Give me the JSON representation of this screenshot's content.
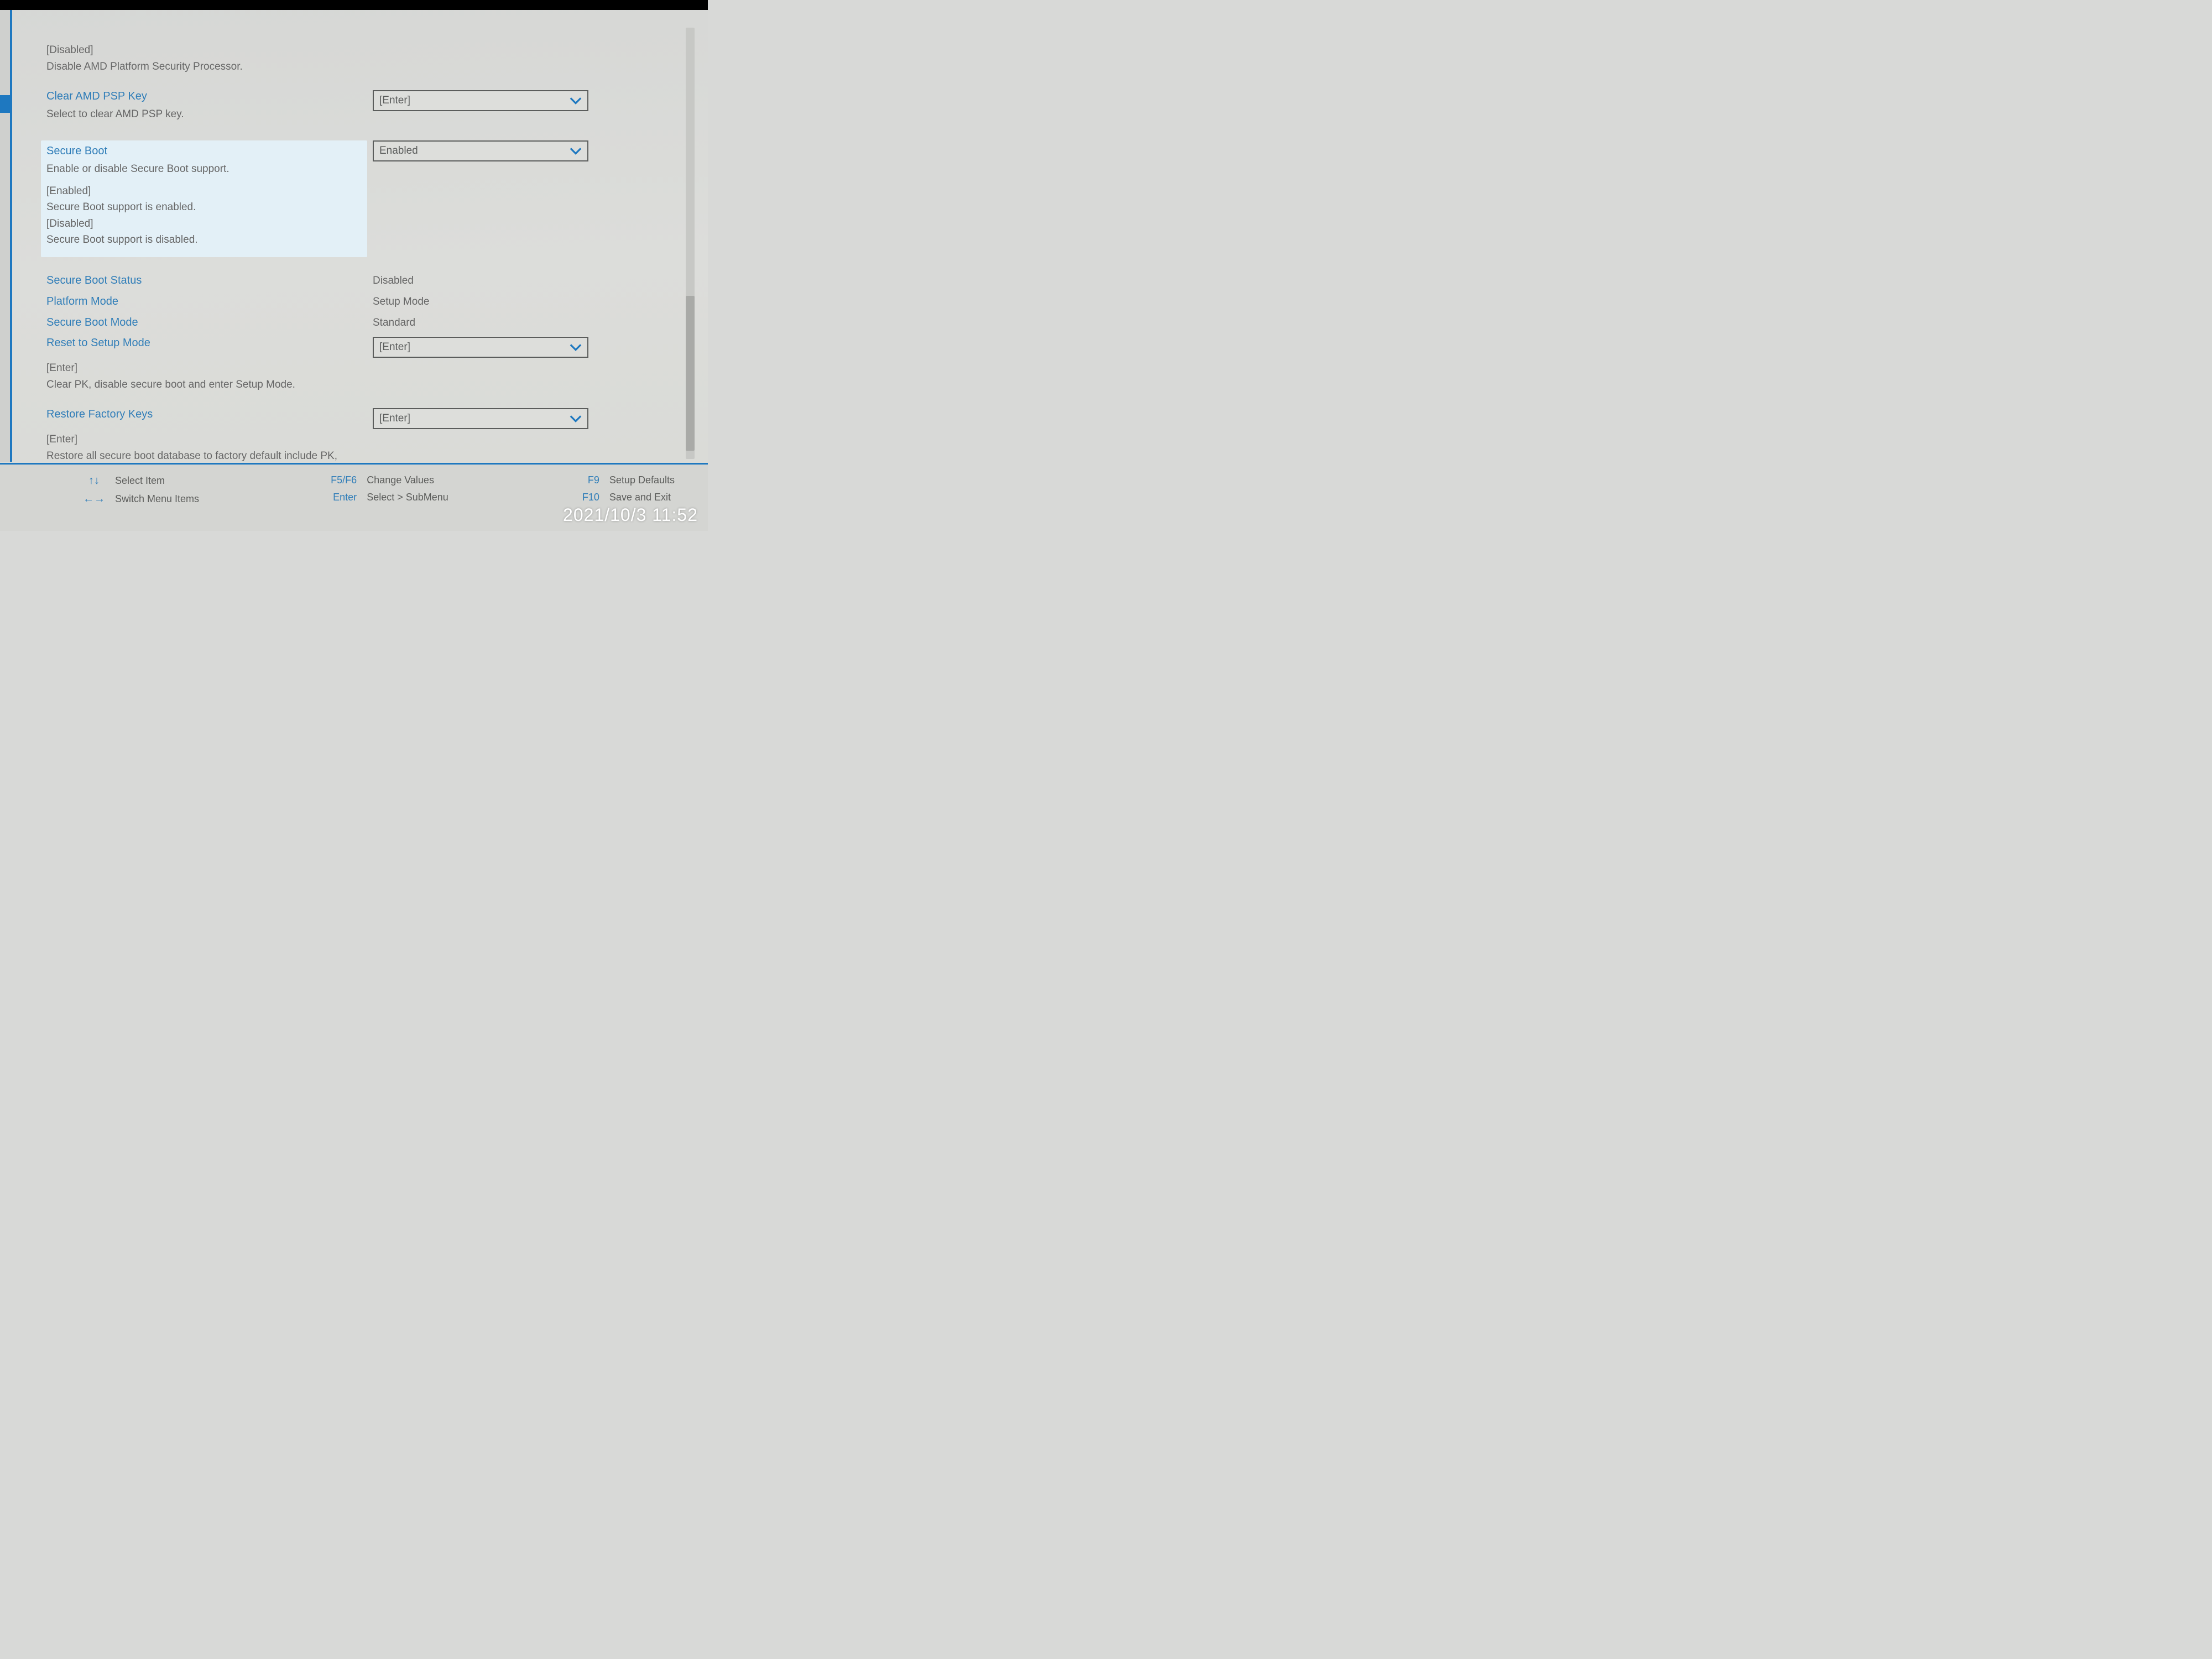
{
  "top": {
    "disabled_tag": "[Disabled]",
    "disabled_desc": "Disable AMD Platform Security Processor."
  },
  "clear_psp": {
    "title": "Clear AMD PSP Key",
    "desc": "Select to clear AMD PSP key.",
    "value": "[Enter]"
  },
  "secure_boot": {
    "title": "Secure Boot",
    "desc": "Enable or disable Secure Boot support.",
    "enabled_tag": "[Enabled]",
    "enabled_desc": "Secure Boot support is enabled.",
    "disabled_tag": "[Disabled]",
    "disabled_desc": "Secure Boot support is disabled.",
    "value": "Enabled"
  },
  "status": {
    "secure_boot_status_label": "Secure Boot Status",
    "secure_boot_status_value": "Disabled",
    "platform_mode_label": "Platform Mode",
    "platform_mode_value": "Setup Mode",
    "secure_boot_mode_label": "Secure Boot Mode",
    "secure_boot_mode_value": "Standard"
  },
  "reset_setup": {
    "title": "Reset to Setup Mode",
    "value": "[Enter]",
    "enter_tag": "[Enter]",
    "desc": "Clear PK, disable secure boot and enter Setup Mode."
  },
  "restore": {
    "title": "Restore Factory Keys",
    "value": "[Enter]",
    "enter_tag": "[Enter]",
    "desc": "Restore all secure boot database to factory default include PK, KEK, db and dbx."
  },
  "footer": {
    "select_item": "Select Item",
    "switch_menu": "Switch Menu Items",
    "f5f6": "F5/F6",
    "change_values": "Change Values",
    "enter": "Enter",
    "select_submenu": "Select > SubMenu",
    "f9": "F9",
    "setup_defaults": "Setup Defaults",
    "f10": "F10",
    "save_exit": "Save and Exit"
  },
  "timestamp": "2021/10/3 11:52"
}
